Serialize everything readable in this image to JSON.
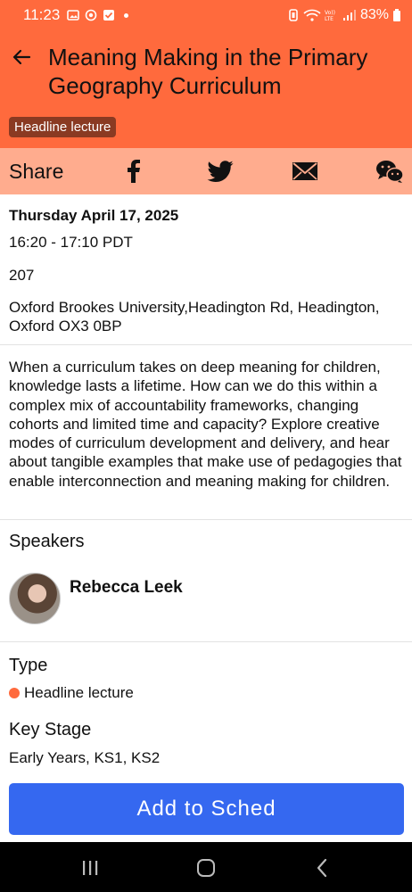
{
  "status_bar": {
    "time": "11:23",
    "battery": "83%",
    "icons": [
      "gallery-icon",
      "location-icon",
      "check-icon",
      "dot-icon",
      "silent-icon",
      "wifi-icon",
      "volte-icon",
      "signal-icon",
      "battery-icon"
    ]
  },
  "header": {
    "title": "Meaning Making in the Primary Geography Curriculum",
    "badge": "Headline lecture",
    "back_icon": "back-arrow-icon"
  },
  "share": {
    "label": "Share",
    "icons": [
      "facebook-icon",
      "twitter-icon",
      "email-icon",
      "wechat-icon"
    ]
  },
  "session": {
    "date": "Thursday April 17, 2025",
    "time": "16:20 - 17:10 PDT",
    "room": "207",
    "address": "Oxford Brookes University,Headington Rd, Headington, Oxford OX3 0BP"
  },
  "description": "When a curriculum takes on deep meaning for children, knowledge lasts a lifetime. How can we do this within a complex mix of accountability frameworks, changing cohorts and limited time and capacity? Explore creative modes of curriculum development and delivery, and hear about tangible examples that make use of pedagogies that enable interconnection and meaning making for children.",
  "speakers": {
    "heading": "Speakers",
    "items": [
      {
        "name": "Rebecca Leek"
      }
    ]
  },
  "type": {
    "heading": "Type",
    "value": "Headline lecture",
    "color": "#ff6a3d"
  },
  "key_stage": {
    "heading": "Key Stage",
    "value": "Early Years, KS1, KS2"
  },
  "action": {
    "add_label": "Add to Sched",
    "color": "#3568f0"
  },
  "nav": {
    "icons": [
      "recent-apps-icon",
      "home-icon",
      "back-icon"
    ]
  },
  "colors": {
    "header": "#ff6a3d",
    "share_bar": "#ffac8e",
    "badge": "#8a3a22"
  }
}
